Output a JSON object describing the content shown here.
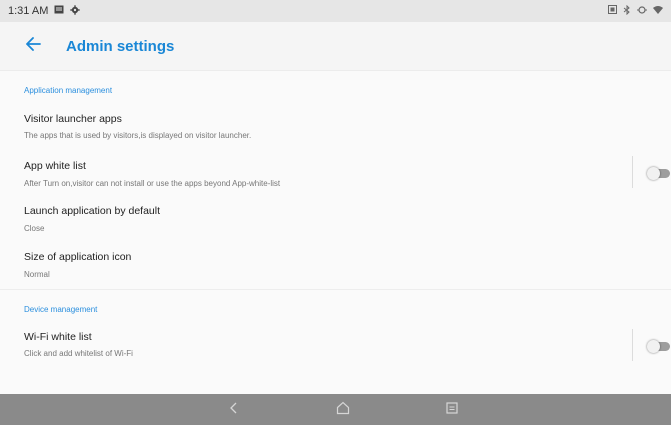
{
  "status_bar": {
    "time": "1:31 AM"
  },
  "app_bar": {
    "title": "Admin settings"
  },
  "sections": [
    {
      "header": "Application management",
      "items": [
        {
          "title": "Visitor launcher apps",
          "subtitle": "The apps that is used by visitors,is displayed on visitor launcher."
        },
        {
          "title": "App white list",
          "subtitle": "After Turn on,visitor can not install or use the apps beyond App-white-list",
          "toggle_on": false
        },
        {
          "title": "Launch application by default",
          "subtitle": "Close"
        },
        {
          "title": "Size of application icon",
          "subtitle": "Normal"
        }
      ]
    },
    {
      "header": "Device management",
      "items": [
        {
          "title": "Wi-Fi white list",
          "subtitle": "Click and add whitelist of Wi-Fi",
          "toggle_on": false
        }
      ]
    }
  ],
  "colors": {
    "accent": "#1a87d6",
    "nav_bar": "#8a8a8a"
  },
  "icons": {
    "back": "arrow-left-icon",
    "nav_back": "chevron-left-icon",
    "nav_home": "home-icon",
    "nav_recents": "recents-icon"
  }
}
